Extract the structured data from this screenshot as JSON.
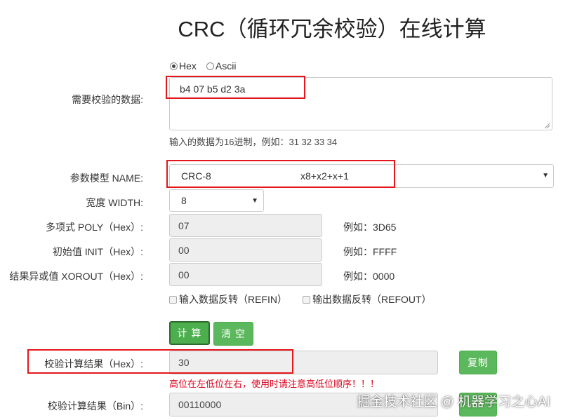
{
  "page": {
    "title": "CRC（循环冗余校验）在线计算"
  },
  "input_format": {
    "options": [
      "Hex",
      "Ascii"
    ],
    "selected": "Hex"
  },
  "data_input": {
    "label": "需要校验的数据:",
    "value": "b4 07 b5 d2 3a",
    "hint": "输入的数据为16进制，例如：31 32 33 34"
  },
  "model": {
    "label": "参数模型 NAME:",
    "name": "CRC-8",
    "polynomial": "x8+x2+x+1"
  },
  "width": {
    "label": "宽度 WIDTH:",
    "value": "8"
  },
  "poly": {
    "label": "多项式 POLY（Hex）:",
    "value": "07",
    "example": "例如：3D65"
  },
  "init": {
    "label": "初始值 INIT（Hex）:",
    "value": "00",
    "example": "例如：FFFF"
  },
  "xorout": {
    "label": "结果异或值 XOROUT（Hex）:",
    "value": "00",
    "example": "例如：0000"
  },
  "refin": {
    "label": "输入数据反转（REFIN）",
    "checked": false
  },
  "refout": {
    "label": "输出数据反转（REFOUT）",
    "checked": false
  },
  "buttons": {
    "calculate": "计 算",
    "clear": "清 空",
    "copy": "复制"
  },
  "result_hex": {
    "label": "校验计算结果（Hex）:",
    "value": "30"
  },
  "warning": "高位在左低位在右，使用时请注意高低位顺序！！！",
  "result_bin": {
    "label": "校验计算结果（Bin）:",
    "value": "00110000"
  },
  "watermark": "掘金技术社区 @ 机器学习之心AI",
  "colors": {
    "green": "#5cb85c",
    "highlight_red": "#e4161b",
    "warning_red": "#d9001b"
  }
}
